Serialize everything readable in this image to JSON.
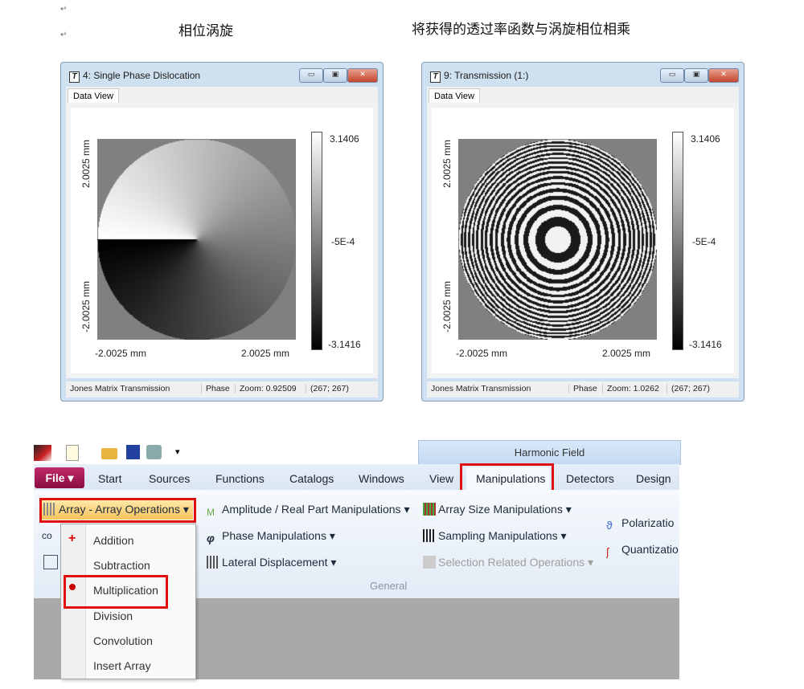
{
  "document": {
    "caption_left": "相位涡旋",
    "caption_right": "将获得的透过率函数与涡旋相位相乘",
    "paragraph_mark": "↵"
  },
  "window_left": {
    "title": "4: Single Phase Dislocation",
    "tab": "Data View",
    "y_top": "2.0025 mm",
    "y_bottom": "-2.0025 mm",
    "x_left": "-2.0025 mm",
    "x_right": "2.0025 mm",
    "cbar_max": "3.1406",
    "cbar_mid": "-5E-4",
    "cbar_min": "-3.1416",
    "status": {
      "type": "Jones Matrix Transmission",
      "mode": "Phase",
      "zoom": "Zoom: 0.92509",
      "size": "(267; 267)"
    }
  },
  "window_right": {
    "title": "9: Transmission (1:)",
    "tab": "Data View",
    "y_top": "2.0025 mm",
    "y_bottom": "-2.0025 mm",
    "x_left": "-2.0025 mm",
    "x_right": "2.0025 mm",
    "cbar_max": "3.1406",
    "cbar_mid": "-5E-4",
    "cbar_min": "-3.1416",
    "status": {
      "type": "Jones Matrix Transmission",
      "mode": "Phase",
      "zoom": "Zoom: 1.0262",
      "size": "(267; 267)"
    }
  },
  "window_buttons": {
    "minimize": "▭",
    "maximize": "▣",
    "close": "✕"
  },
  "ribbon": {
    "contextual_group": "Harmonic Field",
    "file": "File ▾",
    "tabs": [
      "Start",
      "Sources",
      "Functions",
      "Catalogs",
      "Windows",
      "View",
      "Manipulations",
      "Detectors",
      "Design"
    ],
    "active_tab": "Manipulations",
    "array_ops": "Array - Array Operations ▾",
    "amplitude": "Amplitude / Real Part Manipulations ▾",
    "phase": "Phase Manipulations ▾",
    "lateral": "Lateral Displacement ▾",
    "array_size": "Array Size Manipulations ▾",
    "sampling": "Sampling Manipulations ▾",
    "selection": "Selection Related Operations ▾",
    "polarization": "Polarizatio",
    "quantization": "Quantizatio",
    "group_label": "General",
    "menu": [
      "Addition",
      "Subtraction",
      "Multiplication",
      "Division",
      "Convolution",
      "Insert Array"
    ],
    "highlighted_menu_item": "Multiplication"
  }
}
